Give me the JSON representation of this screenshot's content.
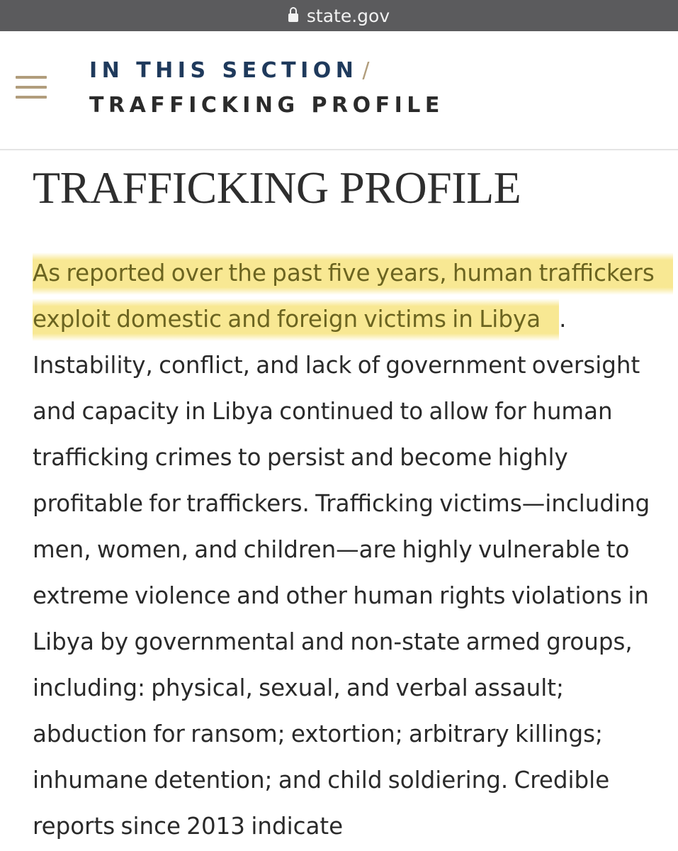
{
  "browser": {
    "url": "state.gov",
    "lock_icon": "lock-icon"
  },
  "section_nav": {
    "menu_icon": "hamburger-menu-icon",
    "breadcrumb_parent": "IN THIS SECTION",
    "breadcrumb_separator": "/",
    "breadcrumb_current": "TRAFFICKING PROFILE"
  },
  "page": {
    "title": "TRAFFICKING PROFILE",
    "highlighted_text": "As reported over the past five years, human traffickers exploit domestic and foreign victims in Libya",
    "body_text": ". Instability, conflict, and lack of government oversight and capacity in Libya continued to allow for human trafficking crimes to persist and become highly profitable for traffickers. Trafficking victims—including men, women, and children—are highly vulnerable to extreme violence and other human rights violations in Libya by governmental and non-state armed groups, including: physical, sexual, and verbal assault; abduction for ransom; extortion; arbitrary killings; inhumane detention; and child soldiering. Credible reports since 2013 indicate"
  },
  "colors": {
    "url_bar_bg": "#5b5b5d",
    "breadcrumb_blue": "#1f3a5c",
    "accent_gold": "#b19d7c",
    "highlight_yellow": "#f7e480",
    "body_text": "#2a2a2a"
  }
}
